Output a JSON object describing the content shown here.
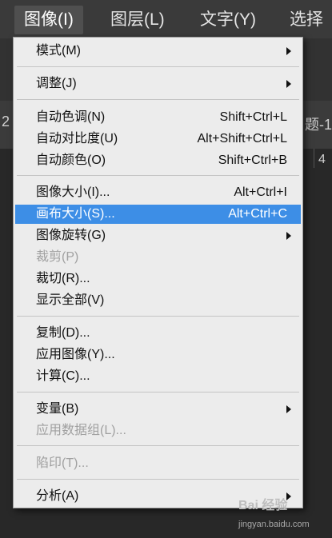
{
  "menubar": {
    "items": [
      {
        "label": "图像(I)"
      },
      {
        "label": "图层(L)"
      },
      {
        "label": "文字(Y)"
      },
      {
        "label": "选择"
      }
    ]
  },
  "background": {
    "fragment_left": "2",
    "fragment_right": "题-1",
    "fragment_num": "4"
  },
  "menu": {
    "items": [
      {
        "label": "模式(M)",
        "submenu": true
      },
      {
        "label": "调整(J)",
        "submenu": true
      },
      {
        "label": "自动色调(N)",
        "shortcut": "Shift+Ctrl+L"
      },
      {
        "label": "自动对比度(U)",
        "shortcut": "Alt+Shift+Ctrl+L"
      },
      {
        "label": "自动颜色(O)",
        "shortcut": "Shift+Ctrl+B"
      },
      {
        "label": "图像大小(I)...",
        "shortcut": "Alt+Ctrl+I"
      },
      {
        "label": "画布大小(S)...",
        "shortcut": "Alt+Ctrl+C",
        "highlighted": true
      },
      {
        "label": "图像旋转(G)",
        "submenu": true
      },
      {
        "label": "裁剪(P)",
        "disabled": true
      },
      {
        "label": "裁切(R)..."
      },
      {
        "label": "显示全部(V)"
      },
      {
        "label": "复制(D)..."
      },
      {
        "label": "应用图像(Y)..."
      },
      {
        "label": "计算(C)..."
      },
      {
        "label": "变量(B)",
        "submenu": true
      },
      {
        "label": "应用数据组(L)...",
        "disabled": true
      },
      {
        "label": "陷印(T)...",
        "disabled": true
      },
      {
        "label": "分析(A)",
        "submenu": true
      }
    ]
  },
  "watermark": {
    "text": "Bai 经验",
    "url": "jingyan.baidu.com"
  },
  "colors": {
    "highlight": "#3d8ee6",
    "menu_bg": "#ececec",
    "menubar_bg": "#3a3a3a"
  }
}
